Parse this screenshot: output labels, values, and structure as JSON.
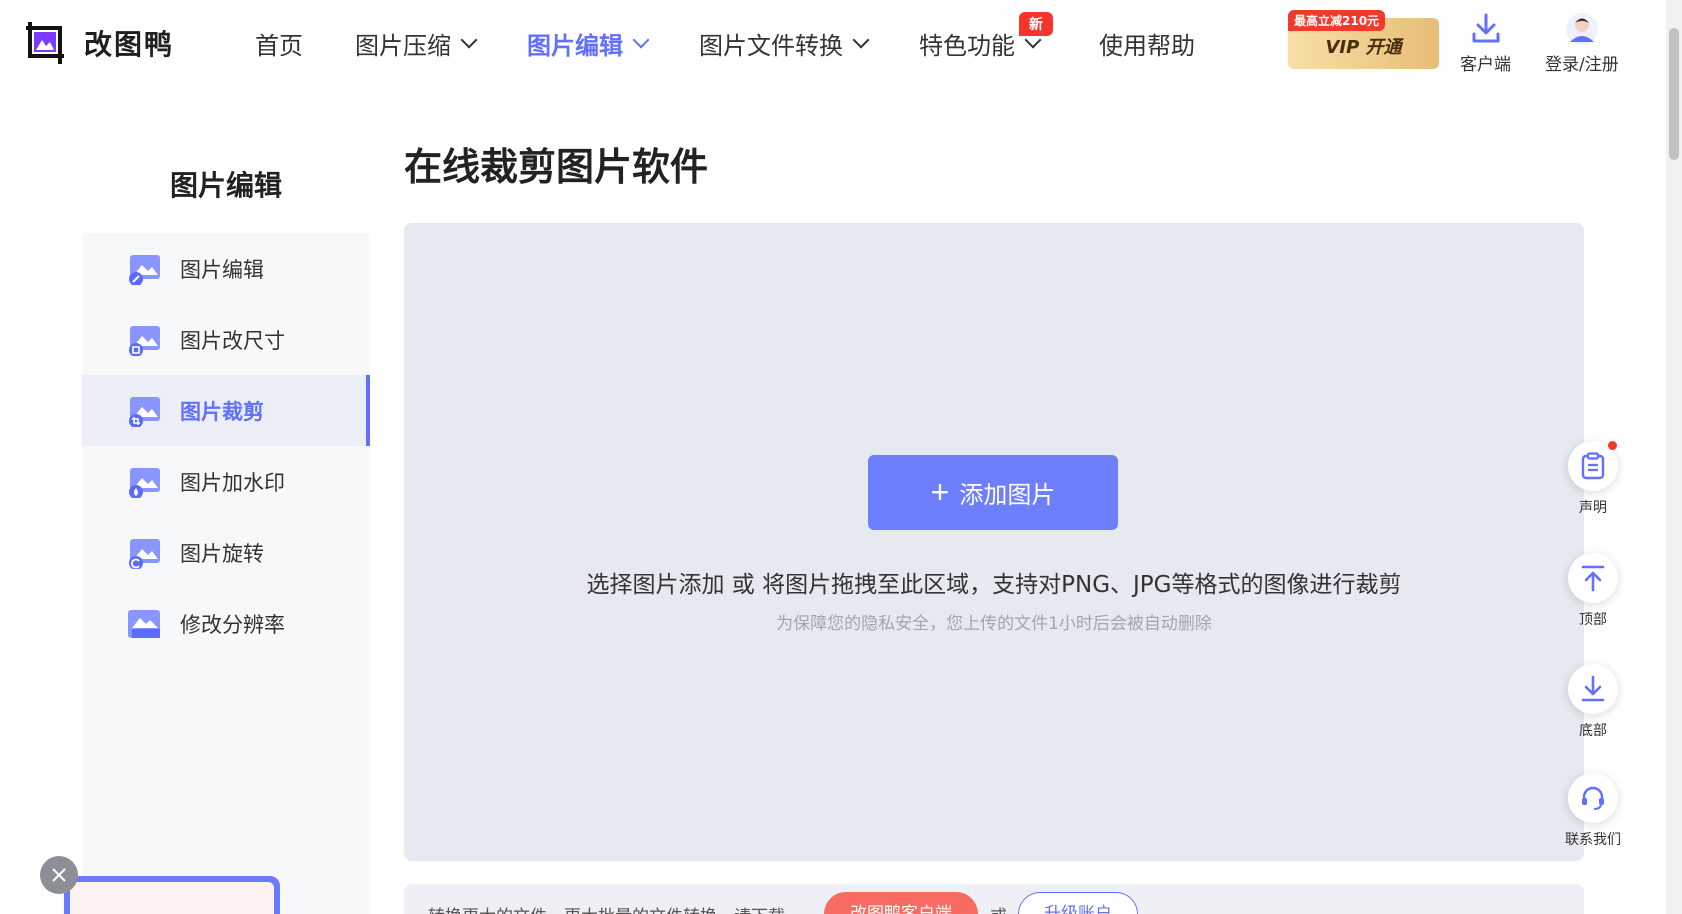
{
  "header": {
    "logo_text": "改图鸭",
    "nav": [
      {
        "label": "首页",
        "dropdown": false,
        "active": false
      },
      {
        "label": "图片压缩",
        "dropdown": true,
        "active": false
      },
      {
        "label": "图片编辑",
        "dropdown": true,
        "active": true
      },
      {
        "label": "图片文件转换",
        "dropdown": true,
        "active": false
      },
      {
        "label": "特色功能",
        "dropdown": true,
        "active": false,
        "badge": "新"
      },
      {
        "label": "使用帮助",
        "dropdown": false,
        "active": false
      }
    ],
    "vip_tag": "最高立减210元",
    "vip_label": "VIP 开通",
    "client_label": "客户端",
    "login_label": "登录/注册"
  },
  "sidebar": {
    "title": "图片编辑",
    "items": [
      {
        "label": "图片编辑",
        "icon": "image-edit-icon",
        "active": false
      },
      {
        "label": "图片改尺寸",
        "icon": "image-resize-icon",
        "active": false
      },
      {
        "label": "图片裁剪",
        "icon": "image-crop-icon",
        "active": true
      },
      {
        "label": "图片加水印",
        "icon": "image-watermark-icon",
        "active": false
      },
      {
        "label": "图片旋转",
        "icon": "image-rotate-icon",
        "active": false
      },
      {
        "label": "修改分辨率",
        "icon": "image-resolution-icon",
        "active": false
      }
    ]
  },
  "main": {
    "title": "在线裁剪图片软件",
    "add_button": "添加图片",
    "drop_text": "选择图片添加 或 将图片拖拽至此区域，支持对PNG、JPG等格式的图像进行裁剪",
    "privacy_note": "为保障您的隐私安全，您上传的文件1小时后会被自动删除"
  },
  "bottom_bar": {
    "text": "转换更大的文件、更大批量的文件转换，请下载",
    "client_button": "改图鸭客户端",
    "or": "或",
    "upgrade_button": "升级账户"
  },
  "float_tools": [
    {
      "label": "声明",
      "icon": "clipboard-icon"
    },
    {
      "label": "顶部",
      "icon": "arrow-up-icon"
    },
    {
      "label": "底部",
      "icon": "arrow-down-icon"
    },
    {
      "label": "联系我们",
      "icon": "headset-icon"
    }
  ],
  "colors": {
    "accent": "#6170ff",
    "button": "#6e7ffd",
    "dropzone": "#e6e9f0",
    "badge_red": "#f5352d"
  }
}
